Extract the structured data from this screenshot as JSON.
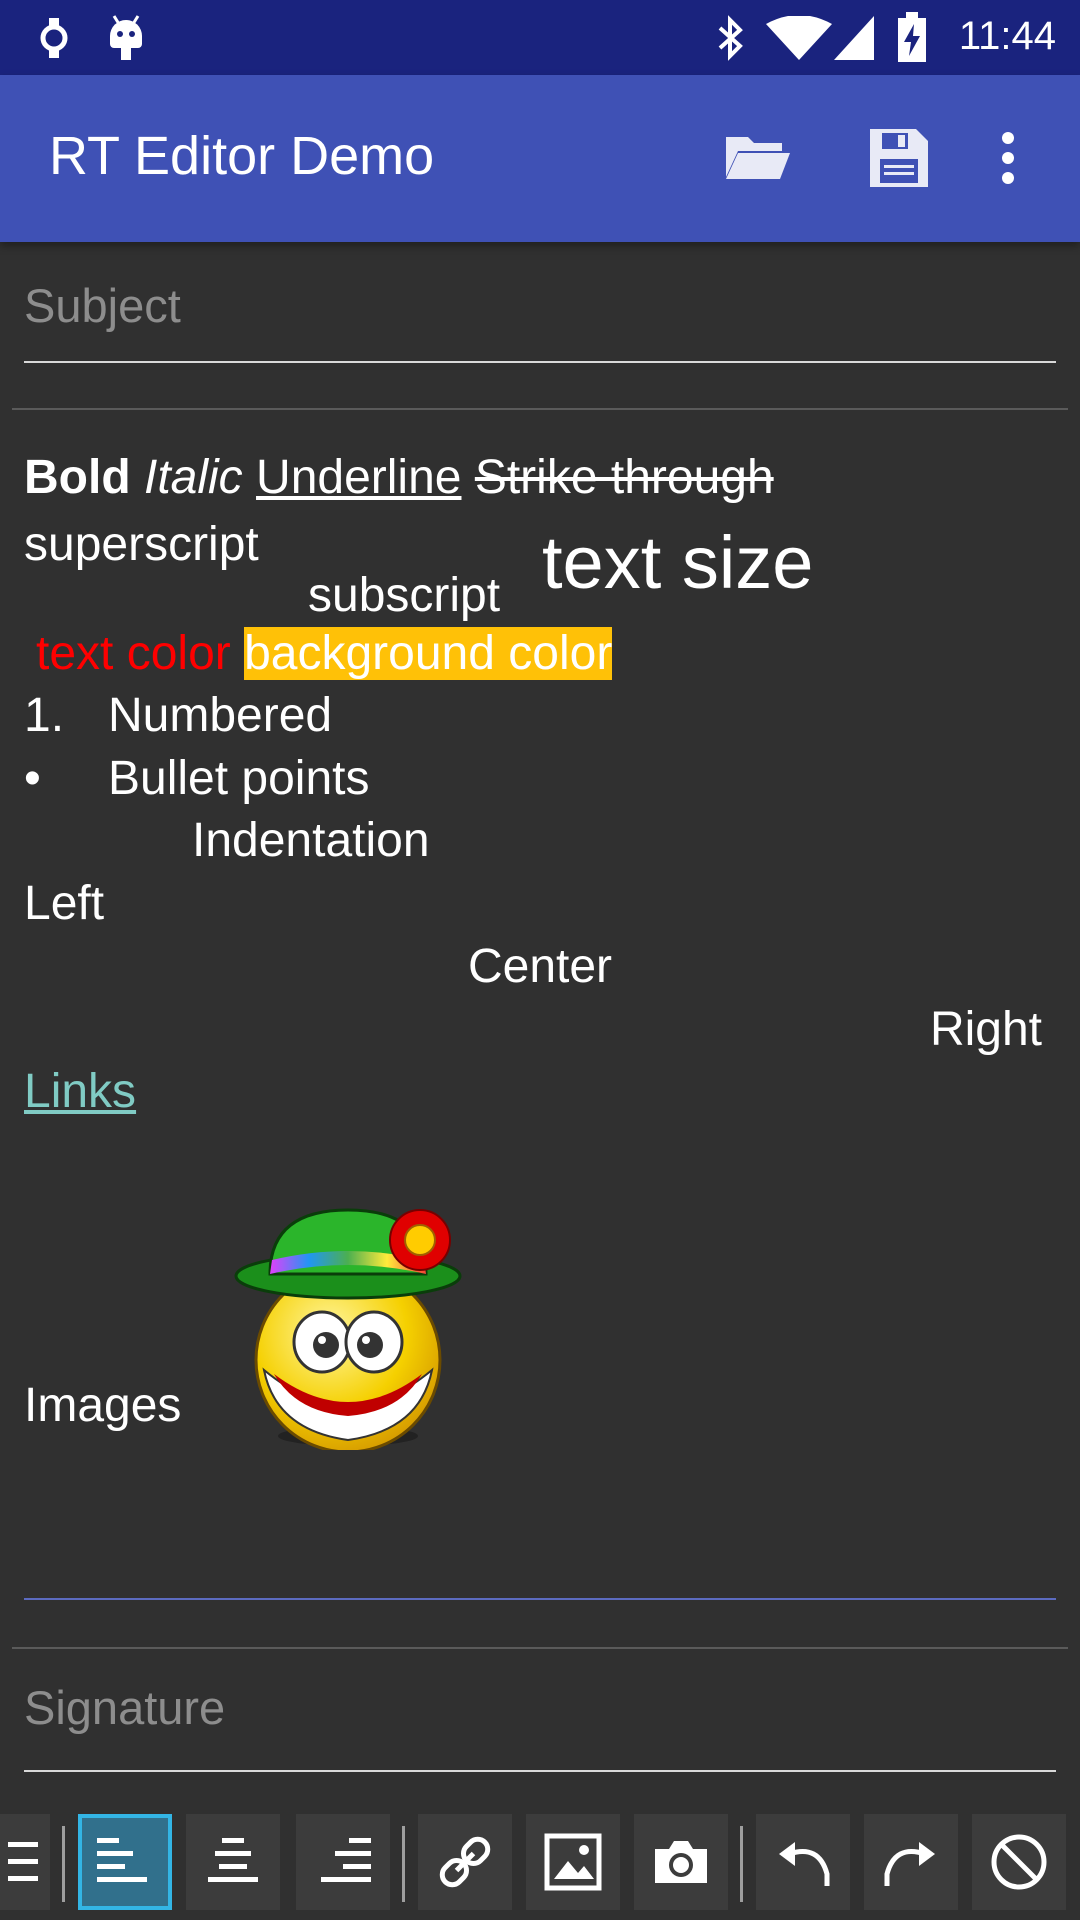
{
  "status_bar": {
    "time": "11:44"
  },
  "app_bar": {
    "title": "RT Editor Demo",
    "actions": [
      "folder-open-icon",
      "save-icon",
      "overflow-menu-icon"
    ]
  },
  "subject": {
    "placeholder": "Subject"
  },
  "content": {
    "bold": "Bold",
    "italic": "Italic",
    "underline": "Underline",
    "strike": "Strike through",
    "superscript": "superscript",
    "subscript": "subscript",
    "text_size": "text size",
    "text_color": "text color",
    "background_color": "background color",
    "numbered_marker": "1.",
    "numbered": "Numbered",
    "bullet_marker": "•",
    "bullet": "Bullet points",
    "indentation": "Indentation",
    "left": "Left",
    "center": "Center",
    "right": "Right",
    "links": "Links",
    "images": "Images"
  },
  "signature": {
    "placeholder": "Signature"
  },
  "colors": {
    "status_bar": "#1a237e",
    "app_bar": "#3f51b5",
    "background": "#303030",
    "text_color_red": "#ff0000",
    "highlight": "#ffc107",
    "link": "#80cbc4",
    "active_tool": "#33b5e5"
  },
  "toolbar": {
    "buttons": [
      "bullet-list-icon",
      "align-left-icon",
      "align-center-icon",
      "align-right-icon",
      "link-icon",
      "image-icon",
      "camera-icon",
      "undo-icon",
      "redo-icon",
      "clear-format-icon"
    ],
    "active": "align-left-icon"
  }
}
